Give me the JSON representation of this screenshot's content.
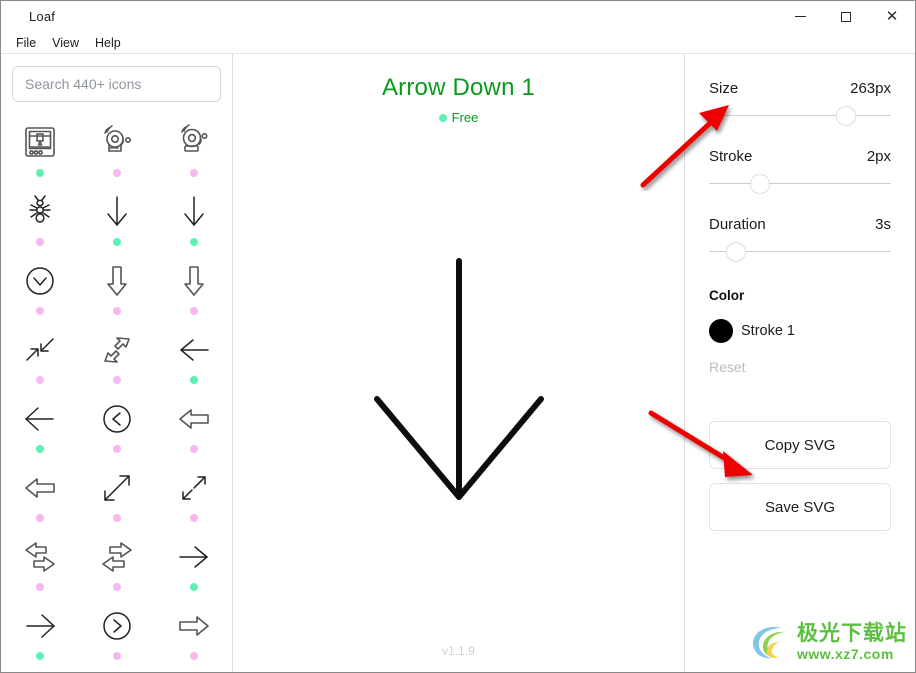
{
  "window": {
    "title": "Loaf",
    "controls": {
      "minimize": "–",
      "maximize": "□",
      "close": "✕"
    }
  },
  "menubar": {
    "items": [
      {
        "label": "File"
      },
      {
        "label": "View"
      },
      {
        "label": "Help"
      }
    ]
  },
  "sidebar": {
    "search": {
      "value": "",
      "placeholder": "Search 440+ icons"
    },
    "icons": [
      {
        "name": "3d-printer-icon",
        "shape": "printer",
        "tier": "free"
      },
      {
        "name": "alarm-bell-icon",
        "shape": "alarm-a",
        "tier": "pro"
      },
      {
        "name": "alarm-bell-alt-icon",
        "shape": "alarm-b",
        "tier": "pro"
      },
      {
        "name": "ant-icon",
        "shape": "ant",
        "tier": "pro"
      },
      {
        "name": "arrow-down-1-icon",
        "shape": "arrow-down",
        "tier": "free"
      },
      {
        "name": "arrow-down-2-icon",
        "shape": "arrow-down",
        "tier": "free"
      },
      {
        "name": "chevron-down-circle-icon",
        "shape": "chevron-circle-down",
        "tier": "pro"
      },
      {
        "name": "arrow-down-block-icon",
        "shape": "block-down",
        "tier": "pro"
      },
      {
        "name": "arrow-down-block-2-icon",
        "shape": "block-down",
        "tier": "pro"
      },
      {
        "name": "arrow-collapse-icon",
        "shape": "collapse",
        "tier": "pro"
      },
      {
        "name": "arrow-expand-block-icon",
        "shape": "expand-block",
        "tier": "pro"
      },
      {
        "name": "arrow-left-thin-icon",
        "shape": "arrow-left-thin",
        "tier": "free"
      },
      {
        "name": "arrow-left-icon",
        "shape": "arrow-left",
        "tier": "free"
      },
      {
        "name": "chevron-left-circle-icon",
        "shape": "chevron-circle-left",
        "tier": "pro"
      },
      {
        "name": "arrow-left-block-icon",
        "shape": "block-left",
        "tier": "pro"
      },
      {
        "name": "arrow-left-block-2-icon",
        "shape": "block-left",
        "tier": "pro"
      },
      {
        "name": "arrow-diagonal-icon",
        "shape": "diagonal",
        "tier": "pro"
      },
      {
        "name": "arrow-expand-diag-icon",
        "shape": "expand-diag",
        "tier": "pro"
      },
      {
        "name": "arrow-swap-block-icon",
        "shape": "swap-block",
        "tier": "pro"
      },
      {
        "name": "arrow-swap-block-2-icon",
        "shape": "swap-block-2",
        "tier": "pro"
      },
      {
        "name": "arrow-right-thin-icon",
        "shape": "arrow-right-thin",
        "tier": "free"
      },
      {
        "name": "arrow-right-icon",
        "shape": "arrow-right",
        "tier": "free"
      },
      {
        "name": "chevron-right-circle-icon",
        "shape": "chevron-circle-right",
        "tier": "pro"
      },
      {
        "name": "arrow-right-block-icon",
        "shape": "block-right",
        "tier": "pro"
      }
    ]
  },
  "preview": {
    "title": "Arrow Down 1",
    "badge": "Free",
    "icon": "arrow-down-1",
    "version": "v1.1.9"
  },
  "panel": {
    "size": {
      "label": "Size",
      "value": "263px",
      "percent": 75
    },
    "stroke": {
      "label": "Stroke",
      "value": "2px",
      "percent": 28
    },
    "duration": {
      "label": "Duration",
      "value": "3s",
      "percent": 15
    },
    "color_section": "Color",
    "color_item": {
      "label": "Stroke 1",
      "hex": "#000000"
    },
    "reset": "Reset",
    "copy_svg": "Copy SVG",
    "save_svg": "Save SVG"
  },
  "annotations": [
    {
      "name": "annotation-arrow-size-slider",
      "color": "#ee0000"
    },
    {
      "name": "annotation-arrow-copy-svg",
      "color": "#ee0000"
    }
  ],
  "watermark": {
    "cn": "极光下载站",
    "url": "www.xz7.com",
    "color": "#5bbf3f"
  },
  "colors": {
    "accent_green": "#0a9a1e",
    "free_dot": "#5ef0b4",
    "pro_dot": "#f6b8ee",
    "border": "#dcdcdc"
  }
}
